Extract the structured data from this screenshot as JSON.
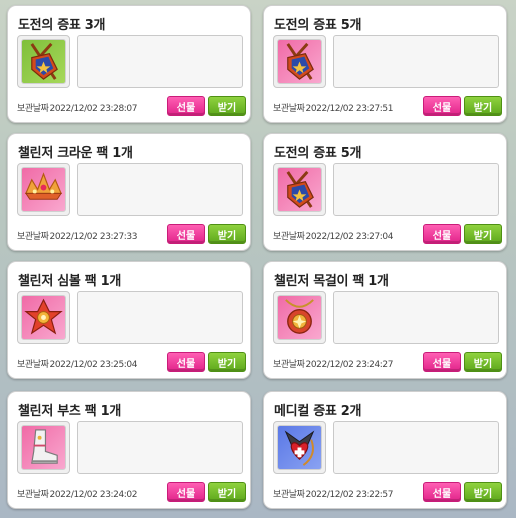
{
  "cards": [
    {
      "title": "도전의 증표 3개",
      "icon": "challenge-emblem-icon",
      "date_label": "보관날짜",
      "date": "2022/12/02 23:28:07",
      "gift": "선물",
      "receive": "받기"
    },
    {
      "title": "도전의 증표 5개",
      "icon": "challenge-emblem-icon",
      "date_label": "보관날짜",
      "date": "2022/12/02 23:27:51",
      "gift": "선물",
      "receive": "받기"
    },
    {
      "title": "챌린저 크라운 팩 1개",
      "icon": "crown-icon",
      "date_label": "보관날짜",
      "date": "2022/12/02 23:27:33",
      "gift": "선물",
      "receive": "받기"
    },
    {
      "title": "도전의 증표 5개",
      "icon": "challenge-emblem-icon",
      "date_label": "보관날짜",
      "date": "2022/12/02 23:27:04",
      "gift": "선물",
      "receive": "받기"
    },
    {
      "title": "챌린저 심볼 팩 1개",
      "icon": "symbol-icon",
      "date_label": "보관날짜",
      "date": "2022/12/02 23:25:04",
      "gift": "선물",
      "receive": "받기"
    },
    {
      "title": "챌린저 목걸이 팩 1개",
      "icon": "necklace-icon",
      "date_label": "보관날짜",
      "date": "2022/12/02 23:24:27",
      "gift": "선물",
      "receive": "받기"
    },
    {
      "title": "챌린저 부츠 팩 1개",
      "icon": "boots-icon",
      "date_label": "보관날짜",
      "date": "2022/12/02 23:24:02",
      "gift": "선물",
      "receive": "받기"
    },
    {
      "title": "메디컬 증표 2개",
      "icon": "medical-emblem-icon",
      "date_label": "보관날짜",
      "date": "2022/12/02 23:22:57",
      "gift": "선물",
      "receive": "받기"
    }
  ],
  "colors": {
    "gift_button": "#e1248a",
    "receive_button": "#5ea81c",
    "icon_bg_green": "#8cc845",
    "icon_bg_pink": "#f48bbd",
    "icon_bg_blue": "#6d88ec"
  }
}
